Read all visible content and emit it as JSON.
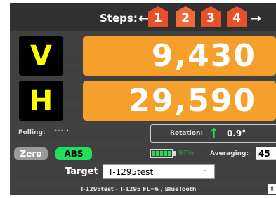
{
  "steps": {
    "label": "Steps:",
    "arrow_left": "←",
    "arrow_right": "→",
    "items": [
      "1",
      "2",
      "3",
      "4"
    ],
    "active": "2"
  },
  "readouts": {
    "v": {
      "axis": "V",
      "value": "9,430"
    },
    "h": {
      "axis": "H",
      "value": "29,590"
    }
  },
  "polling": {
    "label": "Polling:",
    "indicator": "······"
  },
  "rotation": {
    "label": "Rotation:",
    "arrow": "↑",
    "value": "0.9°"
  },
  "buttons": {
    "zero": "Zero",
    "abs": "ABS"
  },
  "battery": {
    "percent": "97%",
    "level": 0.97
  },
  "averaging": {
    "label": "Averaging:",
    "value": "45"
  },
  "target": {
    "label": "Target",
    "selected": "T-1295test",
    "caret": "⌄"
  },
  "status_line": "T-1295test - T-1295 FL=6 / BlueTooth",
  "corner_icon": "expand-icon",
  "colors": {
    "panel_bg": "#434343",
    "value_box": "#f5a02a",
    "axis_text": "#ffff00",
    "step_fill": "#e8502a",
    "green": "#1ee05a"
  }
}
